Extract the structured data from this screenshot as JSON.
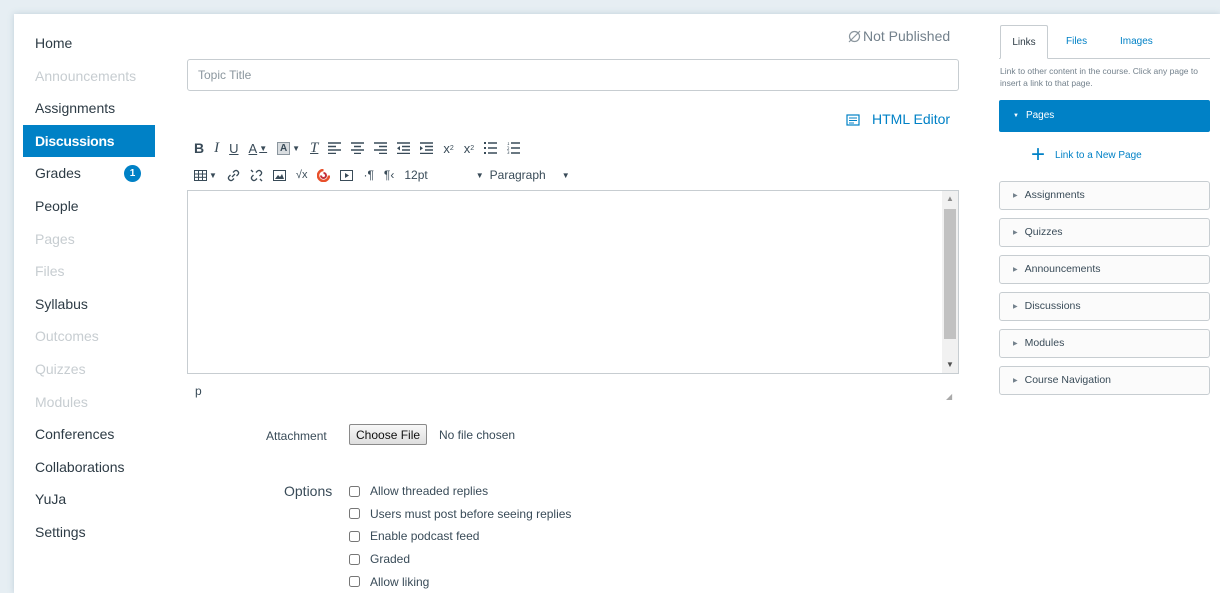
{
  "nav": {
    "items": [
      {
        "label": "Home",
        "state": "normal"
      },
      {
        "label": "Announcements",
        "state": "disabled"
      },
      {
        "label": "Assignments",
        "state": "normal"
      },
      {
        "label": "Discussions",
        "state": "active"
      },
      {
        "label": "Grades",
        "state": "normal",
        "badge": "1"
      },
      {
        "label": "People",
        "state": "normal"
      },
      {
        "label": "Pages",
        "state": "disabled"
      },
      {
        "label": "Files",
        "state": "disabled"
      },
      {
        "label": "Syllabus",
        "state": "normal"
      },
      {
        "label": "Outcomes",
        "state": "disabled"
      },
      {
        "label": "Quizzes",
        "state": "disabled"
      },
      {
        "label": "Modules",
        "state": "disabled"
      },
      {
        "label": "Conferences",
        "state": "normal"
      },
      {
        "label": "Collaborations",
        "state": "normal"
      },
      {
        "label": "YuJa",
        "state": "normal"
      },
      {
        "label": "Settings",
        "state": "normal"
      }
    ]
  },
  "editor": {
    "status": "Not Published",
    "status_icon": "not-published-icon",
    "title_placeholder": "Topic Title",
    "title_value": "",
    "html_editor_label": "HTML Editor",
    "font_size": "12pt",
    "block_format": "Paragraph",
    "path": "p",
    "toolbar_row1": [
      "bold",
      "italic",
      "underline",
      "text-color",
      "background-color",
      "clear-formatting",
      "align-left",
      "align-center",
      "align-right",
      "outdent",
      "indent",
      "superscript",
      "subscript",
      "bullet-list",
      "numbered-list"
    ],
    "toolbar_row2": [
      "table",
      "link",
      "unlink",
      "image",
      "equation",
      "media",
      "embed",
      "ltr",
      "rtl"
    ]
  },
  "attachment": {
    "label": "Attachment",
    "button": "Choose File",
    "file_status": "No file chosen"
  },
  "options": {
    "label": "Options",
    "items": [
      {
        "label": "Allow threaded replies",
        "checked": false
      },
      {
        "label": "Users must post before seeing replies",
        "checked": false
      },
      {
        "label": "Enable podcast feed",
        "checked": false
      },
      {
        "label": "Graded",
        "checked": false
      },
      {
        "label": "Allow liking",
        "checked": false
      }
    ]
  },
  "sidebar": {
    "tabs": [
      "Links",
      "Files",
      "Images"
    ],
    "active_tab": "Links",
    "help": "Link to other content in the course. Click any page to insert a link to that page.",
    "pages_label": "Pages",
    "new_page_label": "Link to a New Page",
    "sections": [
      "Assignments",
      "Quizzes",
      "Announcements",
      "Discussions",
      "Modules",
      "Course Navigation"
    ]
  },
  "colors": {
    "accent": "#0081c6",
    "text": "#2d3b45",
    "disabled": "#c7cdd1"
  }
}
